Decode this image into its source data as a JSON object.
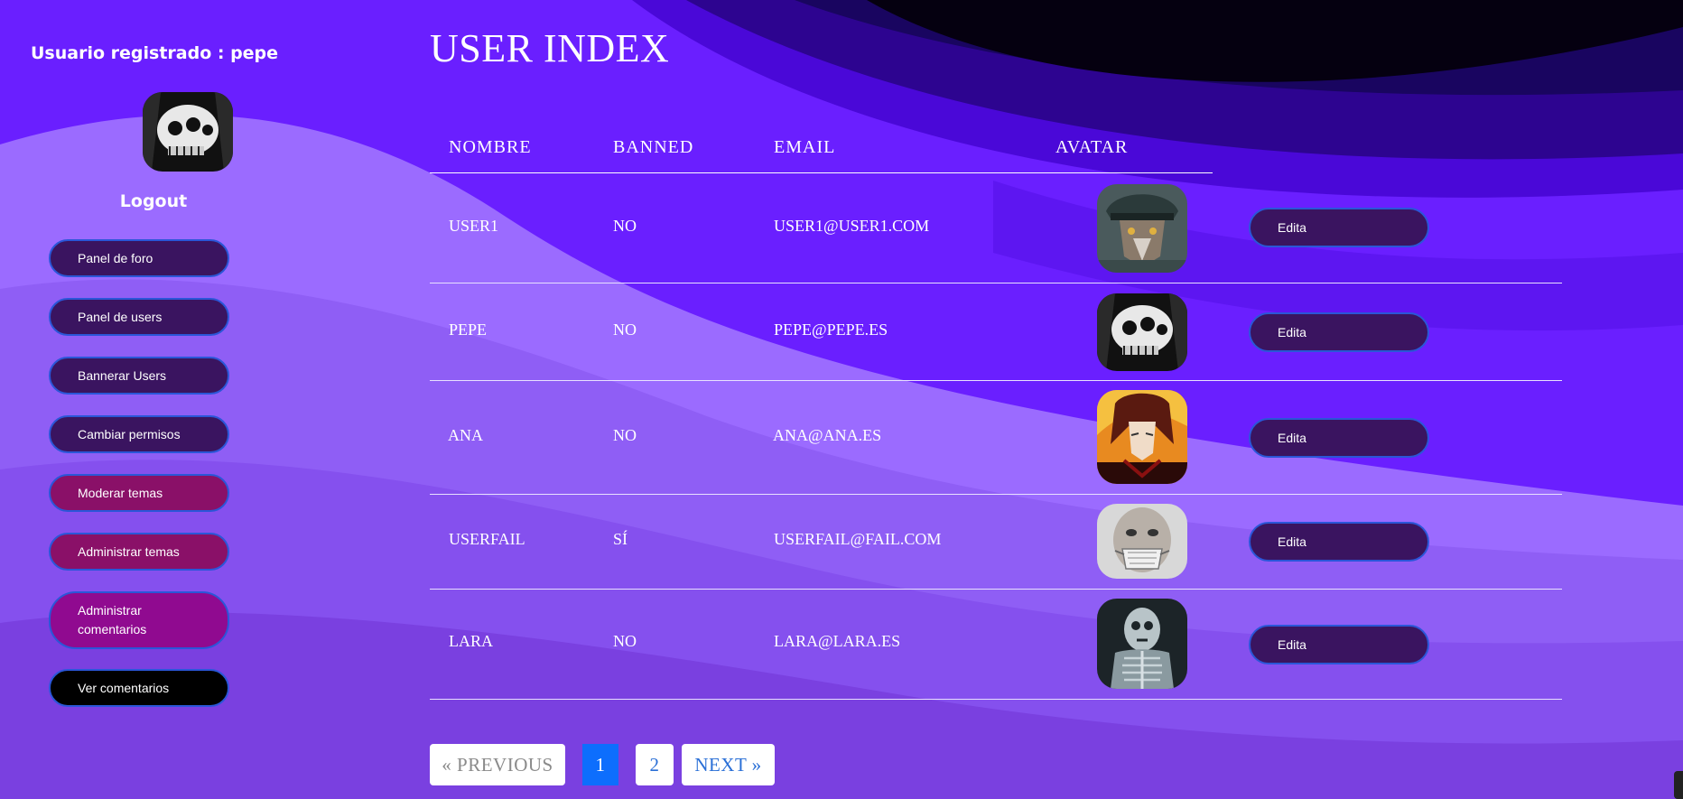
{
  "sidebar": {
    "user_label": "Usuario registrado : pepe",
    "logout": "Logout",
    "items": [
      {
        "label": "Panel de foro",
        "color": "#3a1460"
      },
      {
        "label": "Panel de users",
        "color": "#3a1460"
      },
      {
        "label": "Bannerar Users",
        "color": "#3a1460"
      },
      {
        "label": "Cambiar permisos",
        "color": "#3a1460"
      },
      {
        "label": "Moderar temas",
        "color": "#8a1068"
      },
      {
        "label": "Administrar temas",
        "color": "#8a1068"
      },
      {
        "label": "Administrar comentarios",
        "color": "#900a90"
      },
      {
        "label": "Ver comentarios",
        "color": "#000000"
      }
    ]
  },
  "main": {
    "title": "USER INDEX",
    "columns": [
      "NOMBRE",
      "BANNED",
      "EMAIL",
      "AVATAR"
    ],
    "rows": [
      {
        "nombre": "USER1",
        "banned": "NO",
        "email": "USER1@USER1.COM",
        "avatar": "wolf-soldier-avatar",
        "action": "Edita"
      },
      {
        "nombre": "PEPE",
        "banned": "NO",
        "email": "PEPE@PEPE.ES",
        "avatar": "skull-avatar",
        "action": "Edita"
      },
      {
        "nombre": "ANA",
        "banned": "NO",
        "email": "ANA@ANA.ES",
        "avatar": "anime-character-avatar",
        "action": "Edita"
      },
      {
        "nombre": "USERFAIL",
        "banned": "SÍ",
        "email": "USERFAIL@FAIL.COM",
        "avatar": "masked-face-avatar",
        "action": "Edita"
      },
      {
        "nombre": "LARA",
        "banned": "NO",
        "email": "LARA@LARA.ES",
        "avatar": "skeleton-avatar",
        "action": "Edita"
      }
    ],
    "pagination": {
      "previous": "« PREVIOUS",
      "pages": [
        "1",
        "2"
      ],
      "current": "1",
      "next": "NEXT »"
    }
  },
  "colors": {
    "accent": "#0d6efd",
    "button_border": "#2a56d8",
    "button_fill": "#3a1460"
  }
}
